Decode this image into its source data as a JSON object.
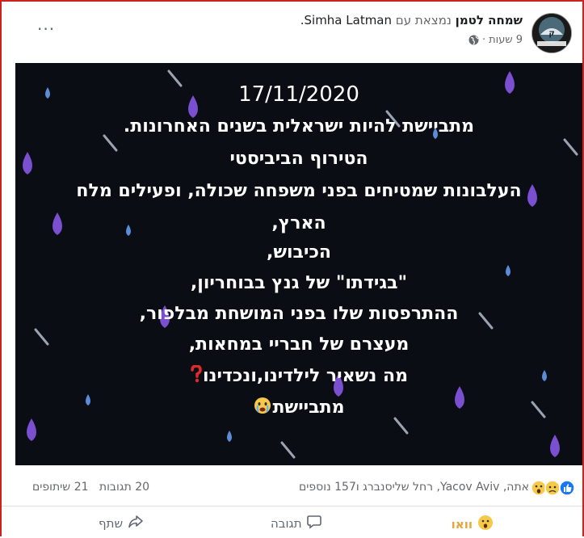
{
  "post": {
    "author": "שמחה לטמן",
    "with_text": "נמצאת עם",
    "tagged": "Simha Latman.",
    "time": "9 שעות",
    "meta_sep": "·",
    "more_label": "···",
    "date_text": "17/11/2020",
    "lines": [
      "מתביישת להיות ישראלית בשנים האחרונות.",
      "הטירוף הביביסטי",
      "העלבונות שמטיחים בפני משפחה שכולה, ופעילים מלח",
      "הארץ,",
      "הכיבוש,",
      "\"בגידתו\" של גנץ בבוחריון,",
      "ההתרפסות שלו בפני המושחת מבלפור,",
      "מעצרם של חבריי במחאות,",
      "מה נשאיר לילדינו,ונכדינו",
      "מתביישת"
    ]
  },
  "stats": {
    "reactors": "אתה, Yacov Aviv, רחל שליסנברג ו157 נוספים",
    "comments": "20 תגובות",
    "shares": "21 שיתופים"
  },
  "actions": {
    "wow": "וואו",
    "comment": "תגובה",
    "share": "שתף"
  },
  "colors": {
    "frame": "#cc2222",
    "post_bg": "#0b0d14",
    "wow": "#e8a33a",
    "like": "#1877f2"
  },
  "icons": [
    "globe-icon",
    "more-icon",
    "question-mark-icon",
    "crying-face-icon",
    "like-icon",
    "sad-icon",
    "wow-icon",
    "comment-icon",
    "share-icon"
  ]
}
